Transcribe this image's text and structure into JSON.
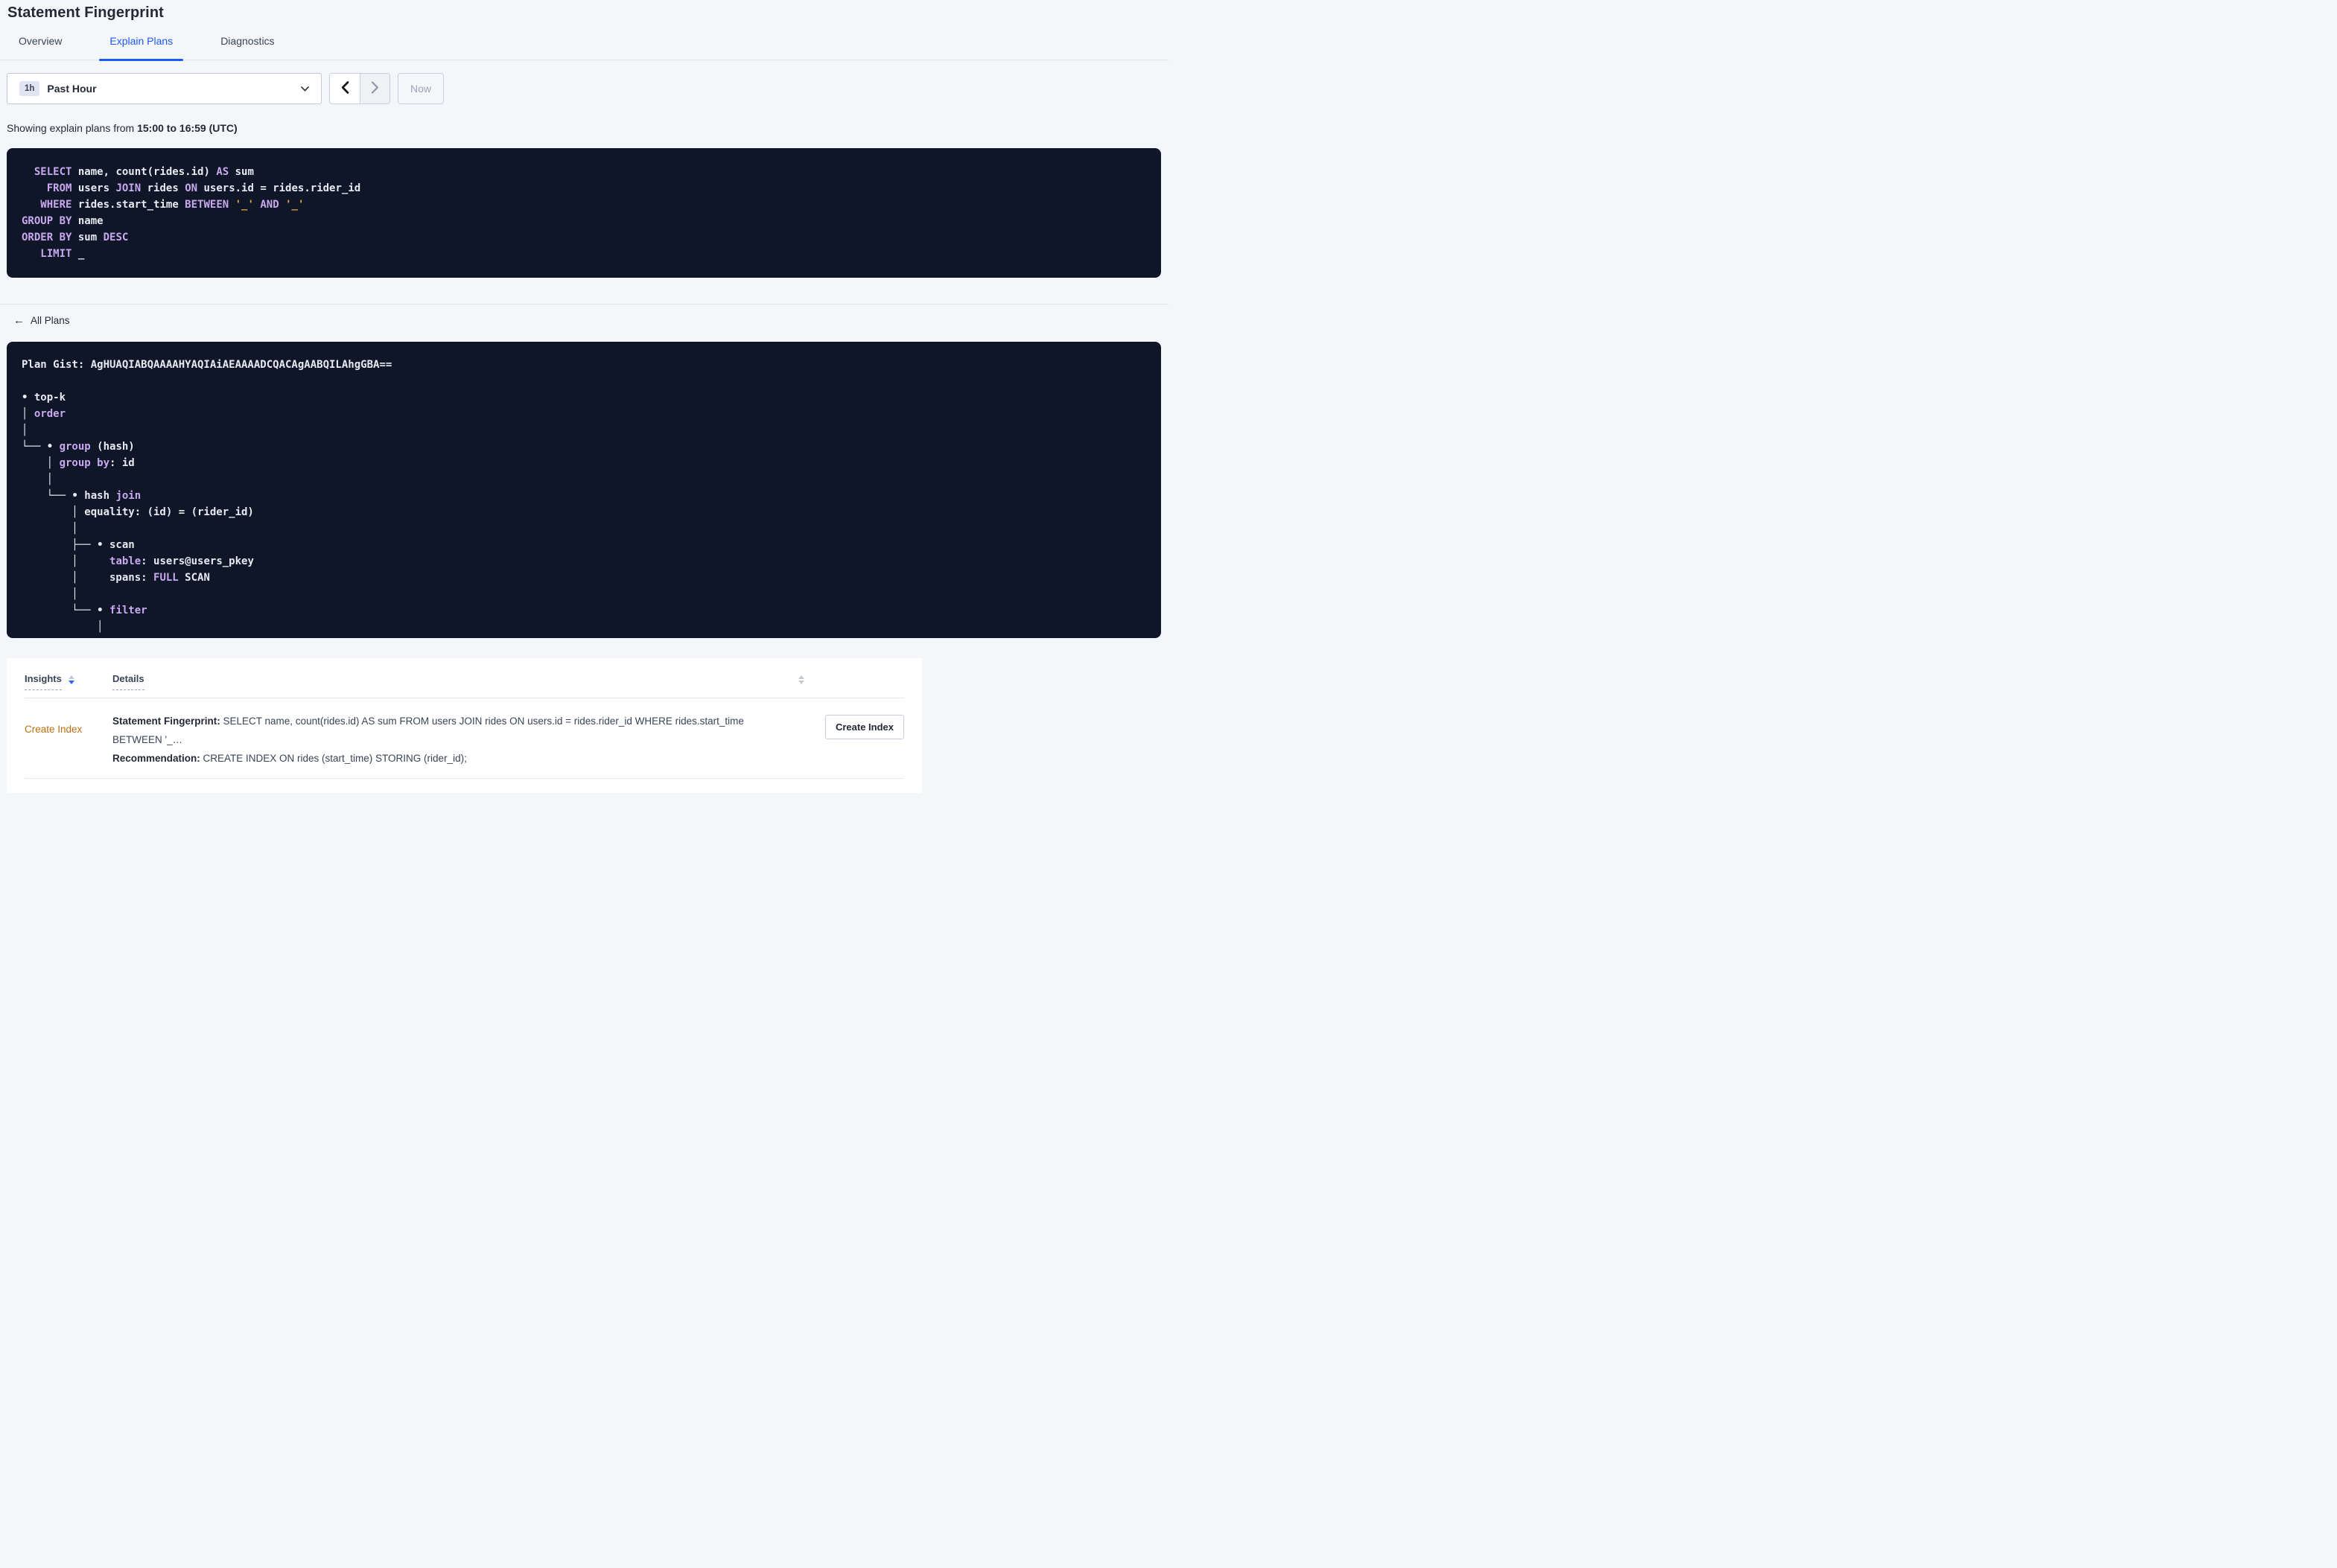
{
  "page": {
    "title": "Statement Fingerprint"
  },
  "tabs": [
    {
      "label": "Overview",
      "active": false
    },
    {
      "label": "Explain Plans",
      "active": true
    },
    {
      "label": "Diagnostics",
      "active": false
    }
  ],
  "time_picker": {
    "badge": "1h",
    "label": "Past Hour",
    "now_label": "Now"
  },
  "showing_text": {
    "prefix": "Showing explain plans from ",
    "range": "15:00 to 16:59 (UTC)"
  },
  "sql_block": {
    "lines": [
      [
        {
          "t": "  ",
          "c": "id"
        },
        {
          "t": "SELECT",
          "c": "kw"
        },
        {
          "t": " name, count(rides.id) ",
          "c": "id"
        },
        {
          "t": "AS",
          "c": "kw"
        },
        {
          "t": " sum",
          "c": "id"
        }
      ],
      [
        {
          "t": "    ",
          "c": "id"
        },
        {
          "t": "FROM",
          "c": "kw"
        },
        {
          "t": " users ",
          "c": "id"
        },
        {
          "t": "JOIN",
          "c": "kw"
        },
        {
          "t": " rides ",
          "c": "id"
        },
        {
          "t": "ON",
          "c": "kw"
        },
        {
          "t": " users.id = rides.rider_id",
          "c": "id"
        }
      ],
      [
        {
          "t": "   ",
          "c": "id"
        },
        {
          "t": "WHERE",
          "c": "kw"
        },
        {
          "t": " rides.start_time ",
          "c": "id"
        },
        {
          "t": "BETWEEN",
          "c": "kw"
        },
        {
          "t": " ",
          "c": "id"
        },
        {
          "t": "'_'",
          "c": "lit"
        },
        {
          "t": " ",
          "c": "id"
        },
        {
          "t": "AND",
          "c": "kw"
        },
        {
          "t": " ",
          "c": "id"
        },
        {
          "t": "'_'",
          "c": "lit"
        }
      ],
      [
        {
          "t": "GROUP BY",
          "c": "kw"
        },
        {
          "t": " name",
          "c": "id"
        }
      ],
      [
        {
          "t": "ORDER BY",
          "c": "kw"
        },
        {
          "t": " sum ",
          "c": "id"
        },
        {
          "t": "DESC",
          "c": "kw"
        }
      ],
      [
        {
          "t": "   ",
          "c": "id"
        },
        {
          "t": "LIMIT",
          "c": "kw"
        },
        {
          "t": " _",
          "c": "id"
        }
      ]
    ]
  },
  "all_plans": {
    "label": "All Plans",
    "arrow_glyph": "←"
  },
  "gist_block": {
    "lines": [
      [
        {
          "t": "Plan Gist: AgHUAQIABQAAAAHYAQIAiAEAAAADCQACAgAABQILAhgGBA==",
          "c": "id"
        }
      ],
      [],
      [
        {
          "t": "• top-k",
          "c": "id"
        }
      ],
      [
        {
          "t": "│ ",
          "c": "id"
        },
        {
          "t": "order",
          "c": "kw"
        }
      ],
      [
        {
          "t": "│",
          "c": "id"
        }
      ],
      [
        {
          "t": "└── • ",
          "c": "id"
        },
        {
          "t": "group",
          "c": "kw"
        },
        {
          "t": " (hash)",
          "c": "id"
        }
      ],
      [
        {
          "t": "    │ ",
          "c": "id"
        },
        {
          "t": "group by",
          "c": "kw"
        },
        {
          "t": ": id",
          "c": "id"
        }
      ],
      [
        {
          "t": "    │",
          "c": "id"
        }
      ],
      [
        {
          "t": "    └── • hash ",
          "c": "id"
        },
        {
          "t": "join",
          "c": "kw"
        }
      ],
      [
        {
          "t": "        │ equality: (id) = (rider_id)",
          "c": "id"
        }
      ],
      [
        {
          "t": "        │",
          "c": "id"
        }
      ],
      [
        {
          "t": "        ├── • scan",
          "c": "id"
        }
      ],
      [
        {
          "t": "        │     ",
          "c": "id"
        },
        {
          "t": "table",
          "c": "kw"
        },
        {
          "t": ": users@users_pkey",
          "c": "id"
        }
      ],
      [
        {
          "t": "        │     spans: ",
          "c": "id"
        },
        {
          "t": "FULL",
          "c": "kw"
        },
        {
          "t": " SCAN",
          "c": "id"
        }
      ],
      [
        {
          "t": "        │",
          "c": "id"
        }
      ],
      [
        {
          "t": "        └── • ",
          "c": "id"
        },
        {
          "t": "filter",
          "c": "kw"
        }
      ],
      [
        {
          "t": "            │",
          "c": "id"
        }
      ]
    ]
  },
  "insights_table": {
    "columns": [
      {
        "label": "Insights"
      },
      {
        "label": "Details"
      }
    ],
    "rows": [
      {
        "insight": "Create Index",
        "details": [
          {
            "label": "Statement Fingerprint:",
            "text": " SELECT name, count(rides.id) AS sum FROM users JOIN rides ON users.id = rides.rider_id WHERE rides.start_time BETWEEN '_…"
          },
          {
            "label": "Recommendation:",
            "text": " CREATE INDEX ON rides (start_time) STORING (rider_id);"
          }
        ],
        "action_label": "Create Index"
      }
    ]
  },
  "icons": {
    "chevron_down": "select-dropdown-chevron",
    "chevron_left": "previous-time-range",
    "chevron_right": "next-time-range",
    "back_arrow": "back-to-all-plans",
    "sort_triangles": "column-sort"
  },
  "colors": {
    "accent_blue": "#1A5CF5",
    "page_bg": "#F5F6FA",
    "code_bg": "#0E1627",
    "code_keyword": "#C9A8F0",
    "code_text": "#E7EAF3",
    "code_literal": "#E6A23C",
    "insight_orange": "#BE6D0D",
    "heading_text": "#242A35",
    "muted_text": "#9AA3B5"
  }
}
